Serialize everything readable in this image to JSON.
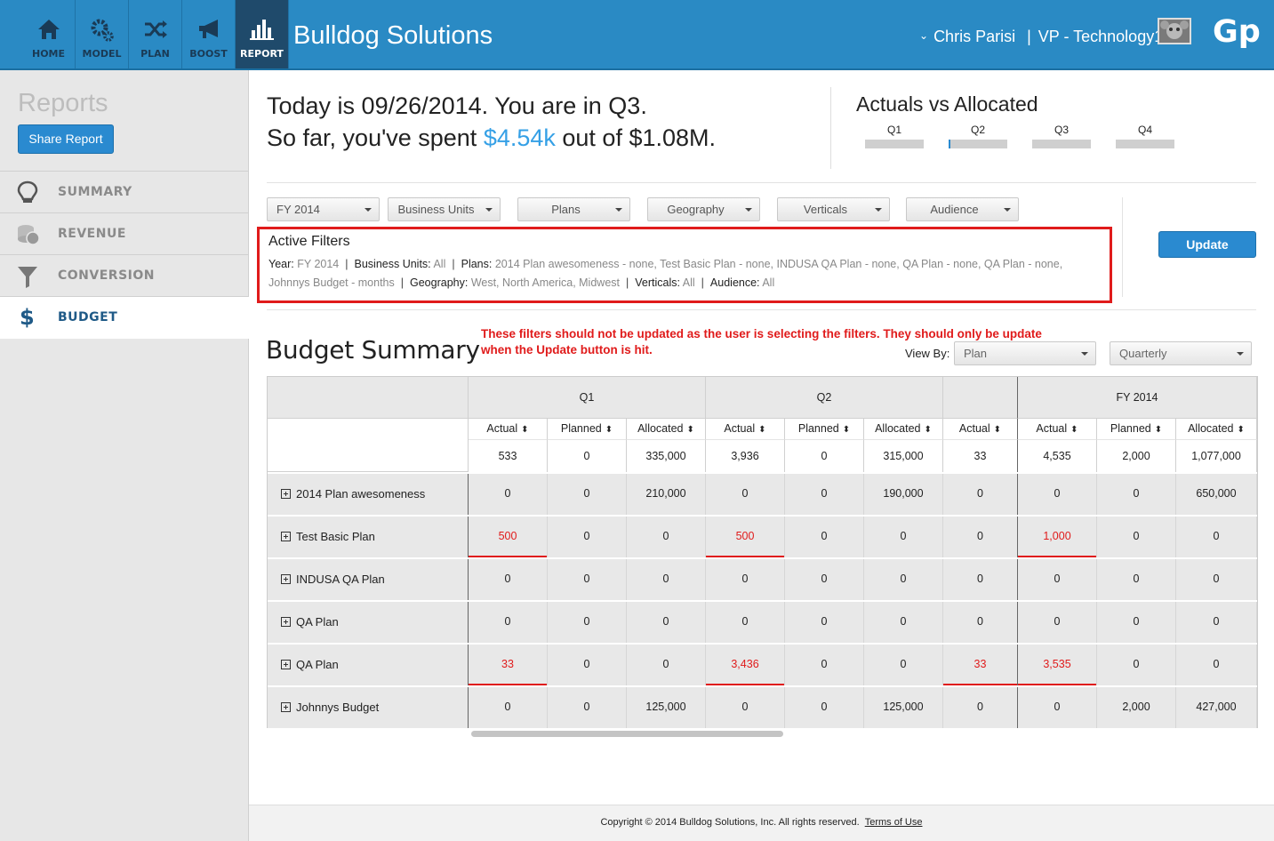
{
  "nav": {
    "items": [
      {
        "label": "HOME",
        "icon": "home-icon"
      },
      {
        "label": "MODEL",
        "icon": "gears-icon"
      },
      {
        "label": "PLAN",
        "icon": "shuffle-icon"
      },
      {
        "label": "BOOST",
        "icon": "megaphone-icon"
      },
      {
        "label": "REPORT",
        "icon": "bar-chart-icon"
      }
    ],
    "active": "REPORT"
  },
  "header": {
    "brand": "Bulldog Solutions",
    "user_name": "Chris Parisi",
    "separator": "|",
    "user_role": "VP - Technology1",
    "logo_text": "Gp"
  },
  "sidebar": {
    "title": "Reports",
    "share_button": "Share Report",
    "items": [
      {
        "label": "SUMMARY",
        "icon": "lightbulb-icon"
      },
      {
        "label": "REVENUE",
        "icon": "coins-icon"
      },
      {
        "label": "CONVERSION",
        "icon": "funnel-icon"
      },
      {
        "label": "BUDGET",
        "icon": "dollar-icon"
      }
    ],
    "active": "BUDGET"
  },
  "summary": {
    "line1": "Today is 09/26/2014. You are in Q3.",
    "line2_prefix": "So far, you've spent ",
    "spent": "$4.54k",
    "line2_suffix": " out of $1.08M."
  },
  "actuals_vs_allocated": {
    "title": "Actuals vs Allocated",
    "quarters": [
      "Q1",
      "Q2",
      "Q3",
      "Q4"
    ]
  },
  "filters": {
    "dropdowns": [
      "FY 2014",
      "Business Units",
      "Plans",
      "Geography",
      "Verticals",
      "Audience"
    ],
    "update_button": "Update"
  },
  "active_filters": {
    "title": "Active Filters",
    "year_label": "Year:",
    "year": "FY 2014",
    "bu_label": "Business Units:",
    "bu": "All",
    "plans_label": "Plans:",
    "plans": "2014 Plan awesomeness - none, Test Basic Plan - none, INDUSA QA Plan - none, QA Plan - none, QA Plan - none,",
    "plans_cont": "Johnnys Budget - months",
    "geo_label": "Geography:",
    "geo": "West, North America, Midwest",
    "verticals_label": "Verticals:",
    "verticals": "All",
    "audience_label": "Audience:",
    "audience": "All",
    "separator": "|"
  },
  "budget": {
    "title": "Budget Summary",
    "note_line1": "These filters should not be updated as the user is selecting the filters. They should only be update",
    "note_line2": "when the Update button is hit.",
    "view_by_label": "View By:",
    "view_by": "Plan",
    "period": "Quarterly",
    "groups": [
      "Q1",
      "Q2",
      "",
      "FY 2014"
    ],
    "columns": [
      "Actual",
      "Planned",
      "Allocated",
      "Actual",
      "Planned",
      "Allocated",
      "Actual",
      "Actual",
      "Planned",
      "Allocated"
    ],
    "sort_icon": "⬍",
    "totals": [
      "533",
      "0",
      "335,000",
      "3,936",
      "0",
      "315,000",
      "33",
      "4,535",
      "2,000",
      "1,077,000"
    ],
    "rows": [
      {
        "name": "2014 Plan awesomeness",
        "values": [
          "0",
          "0",
          "210,000",
          "0",
          "0",
          "190,000",
          "0",
          "0",
          "0",
          "650,000"
        ],
        "red": []
      },
      {
        "name": "Test Basic Plan",
        "values": [
          "500",
          "0",
          "0",
          "500",
          "0",
          "0",
          "0",
          "1,000",
          "0",
          "0"
        ],
        "red": [
          0,
          3,
          7
        ]
      },
      {
        "name": "INDUSA QA Plan",
        "values": [
          "0",
          "0",
          "0",
          "0",
          "0",
          "0",
          "0",
          "0",
          "0",
          "0"
        ],
        "red": []
      },
      {
        "name": "QA Plan",
        "values": [
          "0",
          "0",
          "0",
          "0",
          "0",
          "0",
          "0",
          "0",
          "0",
          "0"
        ],
        "red": []
      },
      {
        "name": "QA Plan",
        "values": [
          "33",
          "0",
          "0",
          "3,436",
          "0",
          "0",
          "33",
          "3,535",
          "0",
          "0"
        ],
        "red": [
          0,
          3,
          6,
          7
        ]
      },
      {
        "name": "Johnnys Budget",
        "values": [
          "0",
          "0",
          "125,000",
          "0",
          "0",
          "125,000",
          "0",
          "0",
          "2,000",
          "427,000"
        ],
        "red": []
      }
    ]
  },
  "footer": {
    "copyright": "Copyright © 2014 Bulldog Solutions, Inc. All rights reserved.",
    "terms": "Terms of Use"
  }
}
